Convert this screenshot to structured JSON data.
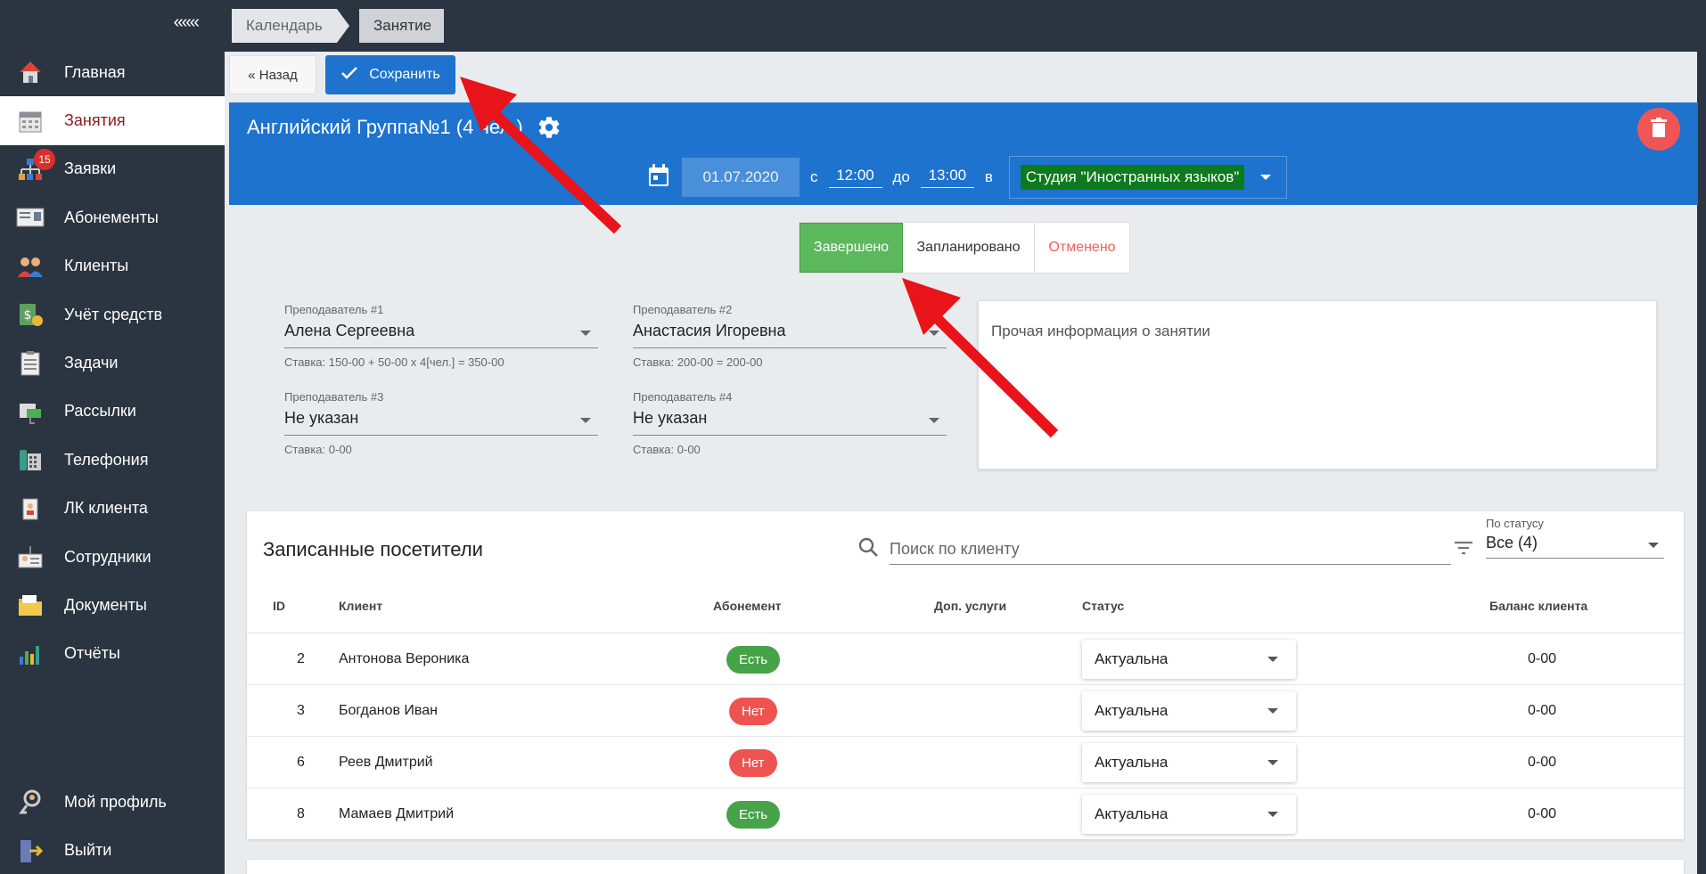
{
  "sidebar": {
    "collapse_label": "«««",
    "items": [
      {
        "label": "Главная",
        "icon": "home-icon"
      },
      {
        "label": "Занятия",
        "icon": "calendar-icon",
        "active": true
      },
      {
        "label": "Заявки",
        "icon": "requests-icon",
        "badge": "15"
      },
      {
        "label": "Абонементы",
        "icon": "subscription-card-icon"
      },
      {
        "label": "Клиенты",
        "icon": "clients-icon"
      },
      {
        "label": "Учёт средств",
        "icon": "money-icon"
      },
      {
        "label": "Задачи",
        "icon": "tasks-icon"
      },
      {
        "label": "Рассылки",
        "icon": "mailing-icon"
      },
      {
        "label": "Телефония",
        "icon": "phone-icon"
      },
      {
        "label": "ЛК клиента",
        "icon": "client-account-icon"
      },
      {
        "label": "Сотрудники",
        "icon": "employees-icon"
      },
      {
        "label": "Документы",
        "icon": "documents-icon"
      },
      {
        "label": "Отчёты",
        "icon": "reports-icon"
      }
    ],
    "bottom": [
      {
        "label": "Мой профиль",
        "icon": "profile-icon"
      },
      {
        "label": "Выйти",
        "icon": "logout-icon"
      }
    ]
  },
  "breadcrumb": [
    "Календарь",
    "Занятие"
  ],
  "toolbar": {
    "back_label": "« Назад",
    "save_label": "Сохранить"
  },
  "lesson": {
    "title": "Английский Группа№1 (4 чел.)",
    "date": "01.07.2020",
    "from_label": "с",
    "time_from": "12:00",
    "to_label": "до",
    "time_to": "13:00",
    "in_label": "в",
    "room": "Студия \"Иностранных языков\""
  },
  "status_tabs": {
    "done": "Завершено",
    "planned": "Запланировано",
    "cancelled": "Отменено",
    "selected": "Завершено"
  },
  "teachers": [
    {
      "label": "Преподаватель #1",
      "value": "Алена Сергеевна",
      "rate": "Ставка: 150-00 + 50-00 x 4[чел.] = 350-00"
    },
    {
      "label": "Преподаватель #2",
      "value": "Анастасия Игоревна",
      "rate": "Ставка: 200-00 = 200-00"
    },
    {
      "label": "Преподаватель #3",
      "value": "Не указан",
      "rate": "Ставка: 0-00"
    },
    {
      "label": "Преподаватель #4",
      "value": "Не указан",
      "rate": "Ставка: 0-00"
    }
  ],
  "notes_placeholder": "Прочая информация о занятии",
  "visitors": {
    "title": "Записанные посетители",
    "search_placeholder": "Поиск по клиенту",
    "filter_label": "По статусу",
    "filter_value": "Все (4)",
    "columns": [
      "ID",
      "Клиент",
      "Абонемент",
      "Доп. услуги",
      "Статус",
      "Баланс клиента"
    ],
    "rows": [
      {
        "id": "2",
        "client": "Антонова Вероника",
        "subscription": "Есть",
        "has": true,
        "extra": "",
        "status": "Актуальна",
        "balance": "0-00"
      },
      {
        "id": "3",
        "client": "Богданов Иван",
        "subscription": "Нет",
        "has": false,
        "extra": "",
        "status": "Актуальна",
        "balance": "0-00"
      },
      {
        "id": "6",
        "client": "Реев Дмитрий",
        "subscription": "Нет",
        "has": false,
        "extra": "",
        "status": "Актуальна",
        "balance": "0-00"
      },
      {
        "id": "8",
        "client": "Мамаев Дмитрий",
        "subscription": "Есть",
        "has": true,
        "extra": "",
        "status": "Актуальна",
        "balance": "0-00"
      }
    ]
  },
  "colors": {
    "accent_blue": "#1e73cf",
    "sidebar": "#2b3441",
    "done_green": "#5cb85c",
    "room_green": "#0c7a1d",
    "arrow_red": "#e8141a"
  }
}
